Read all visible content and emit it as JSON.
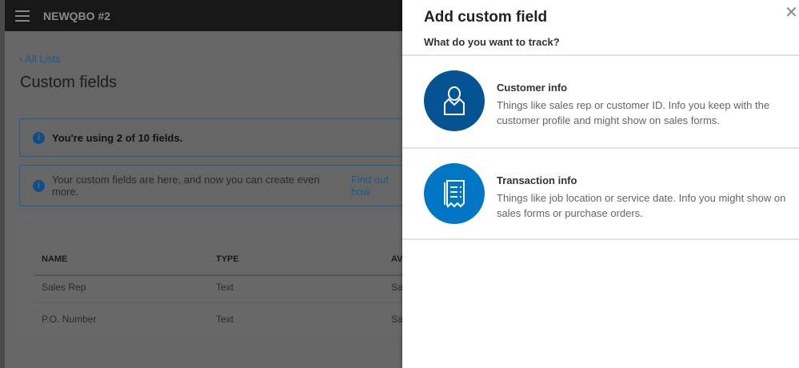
{
  "header": {
    "company": "NEWQBO #2"
  },
  "page": {
    "back_link": "All Lists",
    "title": "Custom fields",
    "info_usage": "You're using 2 of 10 fields.",
    "info_more": "Your custom fields are here, and now you can create even more.",
    "info_link": "Find out how"
  },
  "table": {
    "headers": [
      "NAME",
      "TYPE",
      "AV"
    ],
    "rows": [
      [
        "Sales Rep",
        "Text",
        "Sa"
      ],
      [
        "P.O. Number",
        "Text",
        "Sa"
      ]
    ]
  },
  "panel": {
    "title": "Add custom field",
    "subtitle": "What do you want to track?",
    "options": [
      {
        "title": "Customer info",
        "desc": "Things like sales rep or customer ID. Info you keep with the customer profile and might show on sales forms.",
        "color": "#055393"
      },
      {
        "title": "Transaction info",
        "desc": "Things like job location or service date. Info you might show on sales forms or purchase orders.",
        "color": "#0077c5"
      }
    ]
  }
}
